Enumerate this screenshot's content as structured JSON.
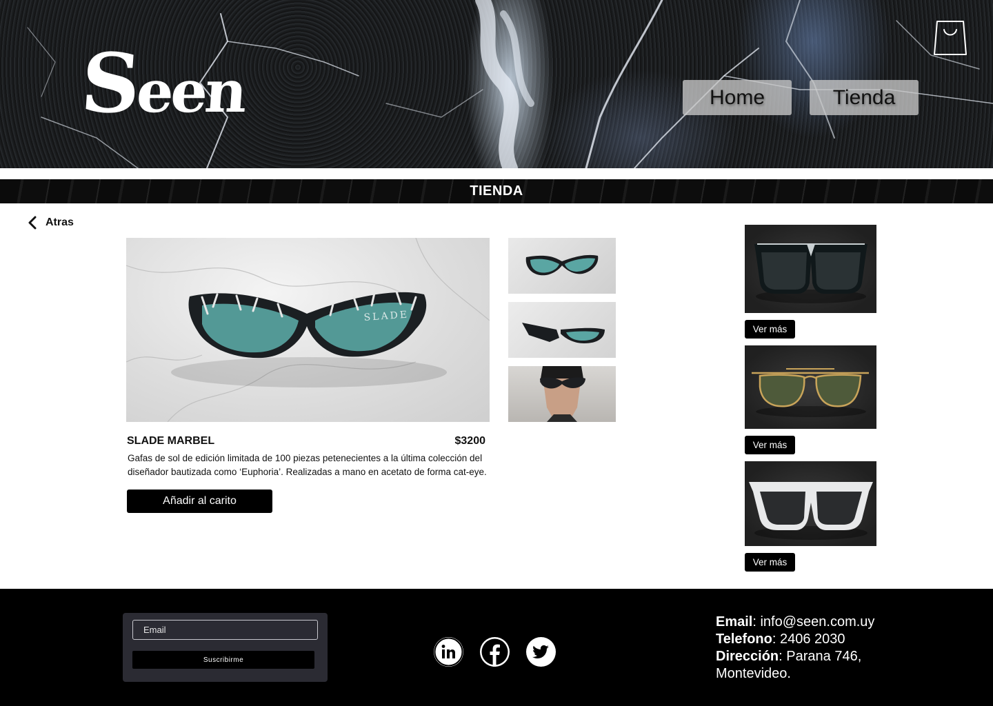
{
  "header": {
    "logo_text_big": "S",
    "logo_text_small": "een",
    "nav": [
      {
        "label": "Home"
      },
      {
        "label": "Tienda"
      }
    ]
  },
  "banner": {
    "title": "TIENDA"
  },
  "back": {
    "label": "Atras"
  },
  "product": {
    "name": "SLADE MARBEL",
    "price": "$3200",
    "description": "Gafas de sol de edición limitada de 100 piezas petenecientes a la última colección del diseñador bautizada como ‘Euphoria’. Realizadas a mano en acetato de forma cat-eye.",
    "add_to_cart_label": "Añadir al carito",
    "frame_text": "SLADE"
  },
  "related": [
    {
      "button": "Ver más"
    },
    {
      "button": "Ver más"
    },
    {
      "button": "Ver más"
    }
  ],
  "footer": {
    "email_placeholder": "Email",
    "subscribe_label": "Suscribirme",
    "contact": {
      "email_label": "Email",
      "email_value": ": info@seen.com.uy",
      "phone_label": "Telefono",
      "phone_value": ": 2406 2030",
      "address_label": "Dirección",
      "address_value": ": Parana 746,",
      "address_line2": "Montevideo."
    }
  },
  "colors": {
    "accent": "#000000",
    "banner_text": "#ffffff",
    "nav_bg": "#c8c8c8",
    "footer_box": "#2b2b33"
  },
  "icons": [
    "cart-icon",
    "chevron-left-icon",
    "linkedin-icon",
    "facebook-icon",
    "twitter-icon"
  ]
}
